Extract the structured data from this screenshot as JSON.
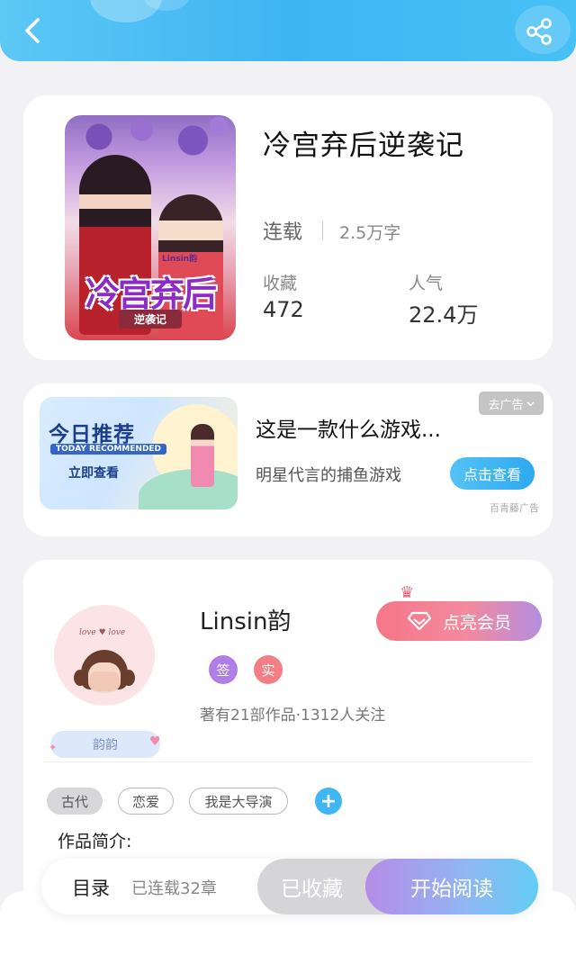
{
  "header": {
    "back_icon": "chevron-left-icon",
    "share_icon": "share-icon",
    "gradient_start": "#5cc8f5",
    "gradient_end": "#46c0f5"
  },
  "book": {
    "cover": {
      "title": "冷宫弃后",
      "subtitle": "逆袭记",
      "author_mark": "Linsin韵"
    },
    "title": "冷宫弃后逆袭记",
    "status": "连载",
    "word_count": "2.5万字",
    "stats": [
      {
        "label": "收藏",
        "value": "472"
      },
      {
        "label": "人气",
        "value": "22.4万"
      }
    ]
  },
  "ad": {
    "image": {
      "headline": "今日推荐",
      "english": "TODAY RECOMMENDED",
      "cta": "立即查看"
    },
    "title": "这是一款什么游戏...",
    "description": "明星代言的捕鱼游戏",
    "button": "点击查看",
    "close_label": "去广告",
    "source": "百青藤广告"
  },
  "author": {
    "avatar_text": "love ♥ love",
    "nickname_badge": "韵韵",
    "name": "Linsin韵",
    "vip_button": "点亮会员",
    "badges": {
      "signed": "签",
      "verified": "实"
    },
    "meta": "著有21部作品·1312人关注",
    "tags": [
      "古代",
      "恋爱",
      "我是大导演"
    ],
    "add_tag": "+",
    "intro_label": "作品简介:"
  },
  "bottom_bar": {
    "toc_label": "目录",
    "toc_count": "已连载32章",
    "collected": "已收藏",
    "read": "开始阅读"
  },
  "colors": {
    "accent_blue": "#40b6f2",
    "vip_pink": "#f57687",
    "signed_purple": "#b07ee6",
    "verified_red": "#f27e86"
  }
}
